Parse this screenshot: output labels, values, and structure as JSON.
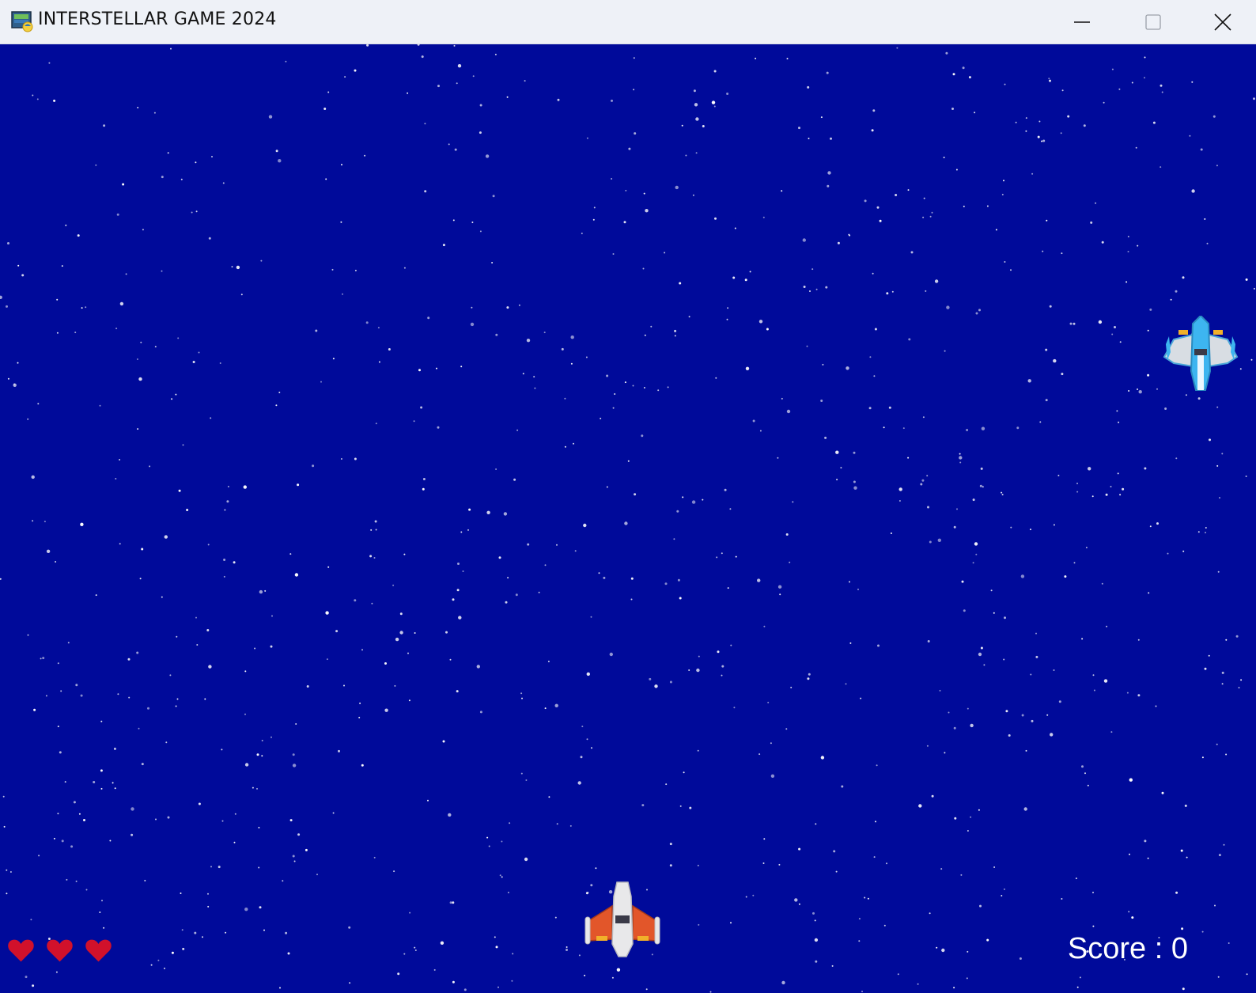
{
  "window": {
    "title": "INTERSTELLAR GAME 2024",
    "icons": {
      "app": "pygame-app-icon",
      "minimize": "minimize-icon",
      "maximize": "maximize-icon",
      "close": "close-icon"
    }
  },
  "game": {
    "background_color": "#000a9a",
    "star_color": "#ffffff",
    "lives": 3,
    "heart_color": "#d1112b",
    "score_text": "Score : 0",
    "player": {
      "icon": "orange-white-spaceship-icon",
      "colors": [
        "#e2562a",
        "#e8e8ea"
      ]
    },
    "enemy": {
      "icon": "blue-white-spaceship-icon",
      "colors": [
        "#3db5f0",
        "#d8dde3",
        "#f1b02a"
      ]
    }
  }
}
